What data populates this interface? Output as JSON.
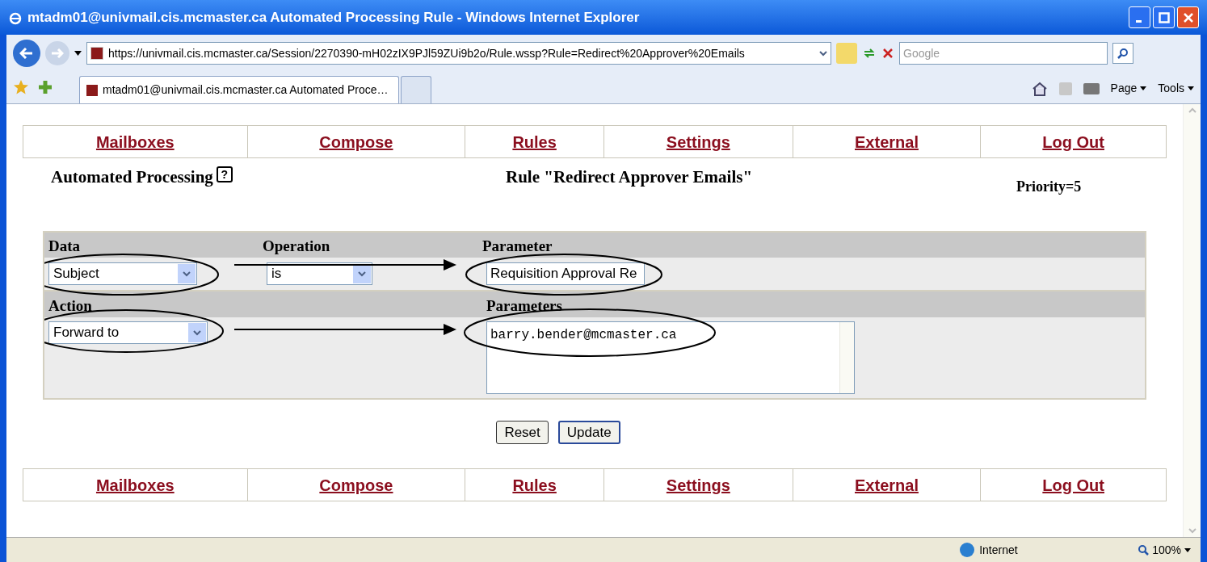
{
  "window": {
    "title": "mtadm01@univmail.cis.mcmaster.ca Automated Processing Rule - Windows Internet Explorer"
  },
  "address_bar": {
    "url": "https://univmail.cis.mcmaster.ca/Session/2270390-mH02zIX9PJl59ZUi9b2o/Rule.wssp?Rule=Redirect%20Approver%20Emails"
  },
  "search": {
    "placeholder": "Google"
  },
  "tabs": [
    {
      "label": "mtadm01@univmail.cis.mcmaster.ca Automated Proce…",
      "selected": true
    }
  ],
  "toolbar": [
    "Page",
    "Tools"
  ],
  "nav_top": [
    "Mailboxes",
    "Compose",
    "Rules",
    "Settings",
    "External",
    "Log Out"
  ],
  "page": {
    "heading": "Automated Processing",
    "help": "?",
    "rule_title": "Rule \"Redirect Approver Emails\"",
    "priority": "Priority=5"
  },
  "rule": {
    "condition_headers": [
      "Data",
      "Operation",
      "Parameter"
    ],
    "data": "Subject",
    "operation": "is",
    "parameter": "Requisition Approval Re",
    "action_header": "Action",
    "parameters_header": "Parameters",
    "action": "Forward to",
    "parameters": "barry.bender@mcmaster.ca"
  },
  "buttons": [
    "Reset",
    "Update"
  ],
  "nav_bottom": [
    "Mailboxes",
    "Compose",
    "Rules",
    "Settings",
    "External",
    "Log Out"
  ],
  "status_bar": {
    "zone": "Internet",
    "zoom": "100%"
  }
}
